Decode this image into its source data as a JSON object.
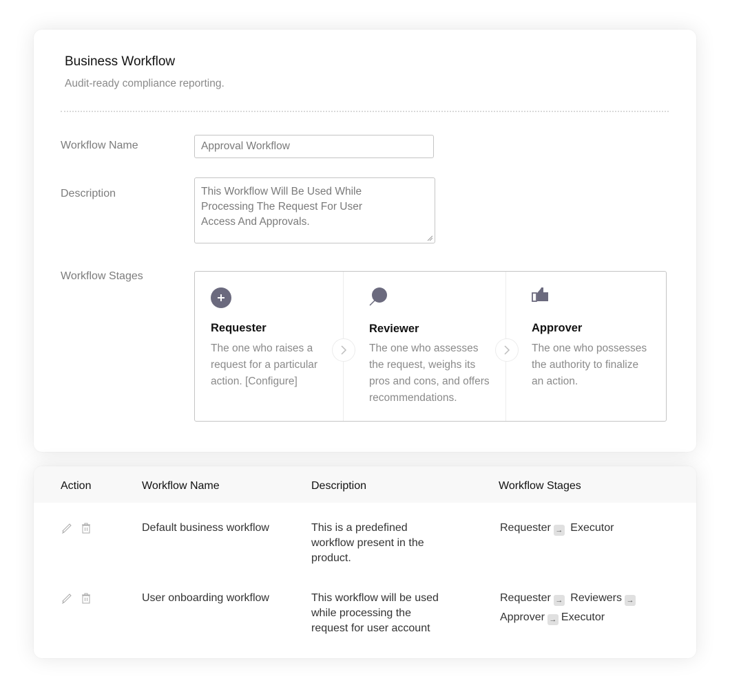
{
  "form": {
    "title": "Business Workflow",
    "subtitle": "Audit-ready compliance reporting.",
    "fields": {
      "name_label": "Workflow Name",
      "name_value": "Approval Workflow",
      "description_label": "Description",
      "description_value": "This Workflow Will Be Used While Processing The Request For User Access And Approvals.",
      "stages_label": "Workflow Stages"
    },
    "stages": [
      {
        "name": "Requester",
        "icon": "plus-circle-icon",
        "description": "The one who raises a request for a particular action. [Configure]"
      },
      {
        "name": "Reviewer",
        "icon": "magnifier-icon",
        "description": "The one who assesses the request, weighs its pros and cons, and offers recommendations."
      },
      {
        "name": "Approver",
        "icon": "thumbs-up-icon",
        "description": "The one who possesses the authority to finalize an action."
      }
    ],
    "icon_color": "#6b6a7e"
  },
  "table": {
    "headers": [
      "Action",
      "Workflow Name",
      "Description",
      "Workflow Stages"
    ],
    "rows": [
      {
        "name": "Default business workflow",
        "description": "This is a predefined workflow present in the product.",
        "stages": [
          "Requester",
          "Executor"
        ]
      },
      {
        "name": "User onboarding workflow",
        "description": "This workflow will be used while processing the request for user account",
        "stages": [
          "Requester",
          "Reviewers",
          "Approver",
          "Executor"
        ]
      }
    ]
  }
}
